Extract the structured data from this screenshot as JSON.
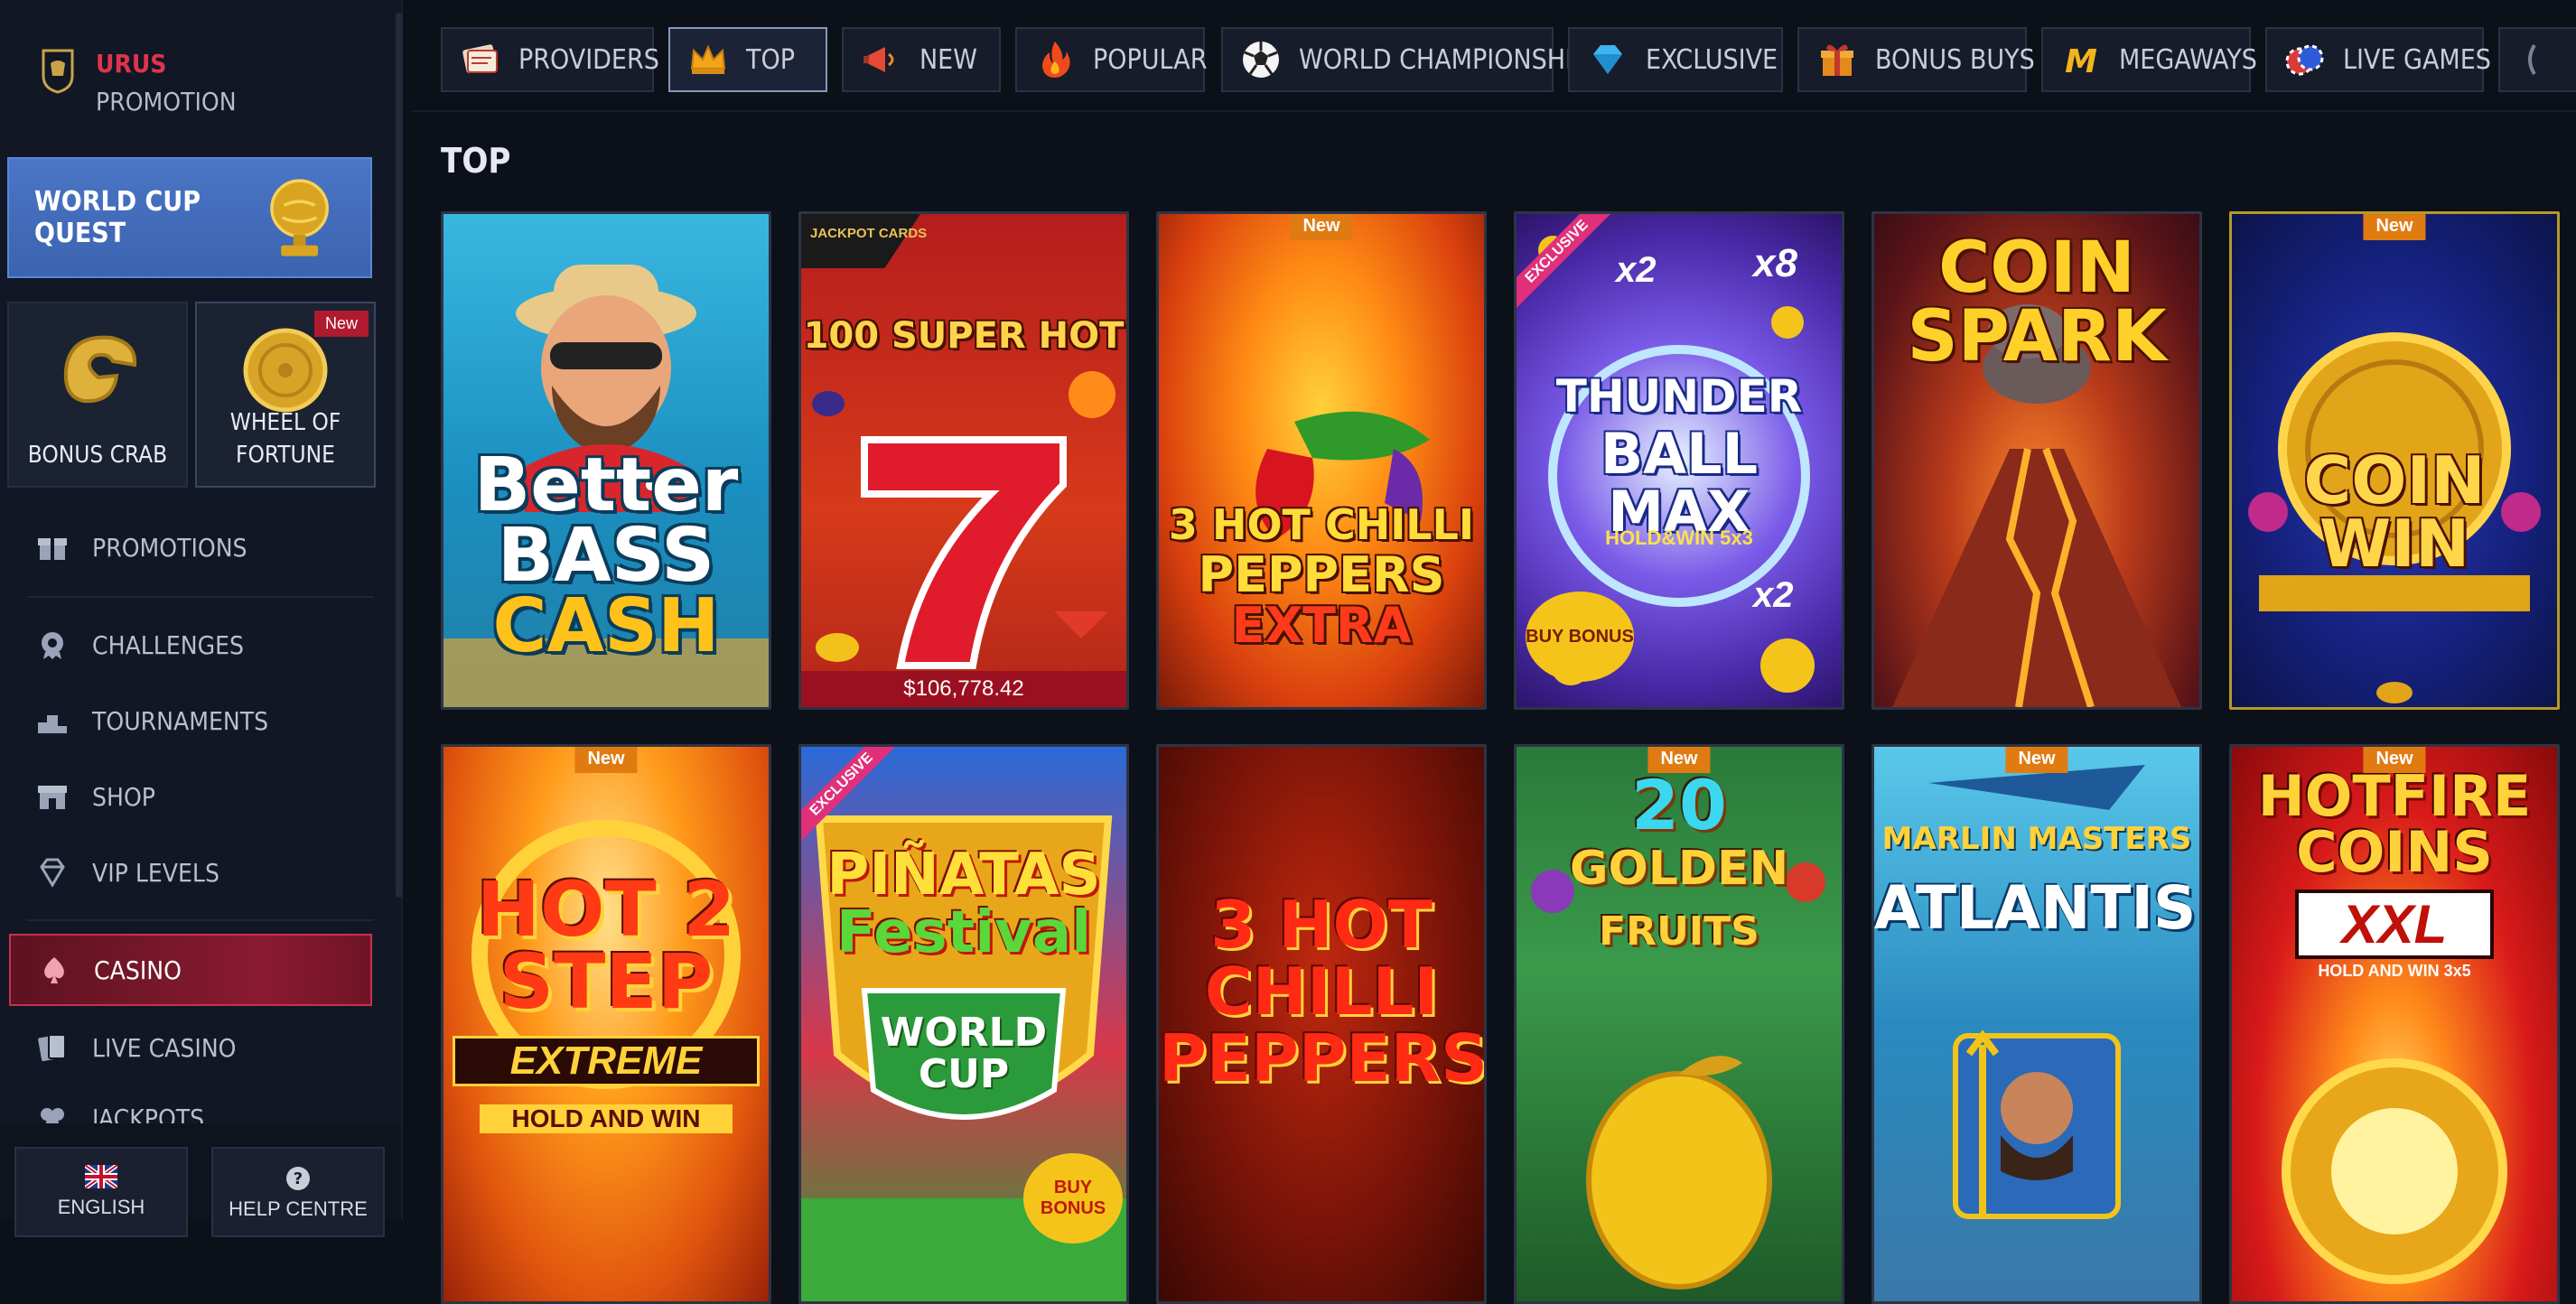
{
  "brand": {
    "line1": "URUS",
    "line2": "PROMOTION"
  },
  "sidebar": {
    "quest": {
      "label": "WORLD CUP QUEST"
    },
    "tiles": [
      {
        "label": "BONUS CRAB",
        "badge": ""
      },
      {
        "label_lines": [
          "WHEEL OF",
          "FORTUNE"
        ],
        "badge": "New"
      }
    ],
    "items": [
      {
        "label": "PROMOTIONS",
        "icon": "gift-icon"
      },
      {
        "label": "CHALLENGES",
        "icon": "gear-badge-icon"
      },
      {
        "label": "TOURNAMENTS",
        "icon": "podium-icon"
      },
      {
        "label": "SHOP",
        "icon": "shop-icon"
      },
      {
        "label": "VIP LEVELS",
        "icon": "diamond-icon"
      },
      {
        "label": "CASINO",
        "icon": "spade-icon",
        "active": true
      },
      {
        "label": "LIVE CASINO",
        "icon": "cards-icon"
      },
      {
        "label": "JACKPOTS",
        "icon": "clover-icon"
      }
    ],
    "footer": {
      "language": "ENGLISH",
      "help": "HELP CENTRE"
    }
  },
  "topnav": {
    "items": [
      {
        "label": "PROVIDERS",
        "icon": "providers-icon"
      },
      {
        "label": "TOP",
        "icon": "crown-icon",
        "active": true
      },
      {
        "label": "NEW",
        "icon": "megaphone-icon"
      },
      {
        "label": "POPULAR",
        "icon": "fire-icon"
      },
      {
        "label": "WORLD CHAMPIONSHIP",
        "icon": "soccer-ball-icon"
      },
      {
        "label": "EXCLUSIVE",
        "icon": "gem-icon"
      },
      {
        "label": "BONUS BUYS",
        "icon": "gift-box-icon"
      },
      {
        "label": "MEGAWAYS",
        "icon": "megaways-m-icon"
      },
      {
        "label": "LIVE GAMES",
        "icon": "chips-icon"
      }
    ]
  },
  "main": {
    "section_title": "TOP",
    "games": [
      {
        "title_lines": [
          "Better",
          "BASS",
          "CASH"
        ],
        "badge": ""
      },
      {
        "title": "100 SUPER HOT",
        "logo": "JACKPOT CARDS",
        "jackpot": "$106,778.42",
        "badge": ""
      },
      {
        "title_lines": [
          "3 HOT CHILLI",
          "PEPPERS",
          "EXTRA"
        ],
        "badge": "New"
      },
      {
        "title_lines": [
          "THUNDER",
          "BALL",
          "MAX"
        ],
        "subtitle": "HOLD&WIN 5x3",
        "multipliers": [
          "x2",
          "x8",
          "x2"
        ],
        "buy_label": "BUY BONUS",
        "ribbon": "EXCLUSIVE"
      },
      {
        "title_lines": [
          "COIN",
          "SPARK"
        ],
        "badge": ""
      },
      {
        "title_lines": [
          "COIN",
          "WIN"
        ],
        "badge": "New"
      },
      {
        "title_lines": [
          "HOT 2",
          "STEP",
          "EXTREME"
        ],
        "subtitle": "HOLD AND WIN",
        "badge": "New"
      },
      {
        "title_lines": [
          "PIÑATAS",
          "Festival",
          "WORLD",
          "CUP"
        ],
        "buy_label": "BUY BONUS",
        "ribbon": "EXCLUSIVE"
      },
      {
        "title_lines": [
          "3 HOT",
          "CHILLI",
          "PEPPERS"
        ],
        "badge": ""
      },
      {
        "title_lines": [
          "20",
          "GOLDEN",
          "FRUITS"
        ],
        "badge": "New"
      },
      {
        "title_lines": [
          "MARLIN MASTERS",
          "ATLANTIS™"
        ],
        "badge": "New"
      },
      {
        "title_lines": [
          "HOTFIRE",
          "COINS",
          "XXL"
        ],
        "subtitle": "HOLD AND WIN 3x5",
        "badge": "New"
      }
    ]
  },
  "colors": {
    "accent_red": "#c9304c",
    "quest_blue": "#4a76c5",
    "badge_orange": "#e07b12",
    "exclusive_pink": "#e0307a"
  }
}
